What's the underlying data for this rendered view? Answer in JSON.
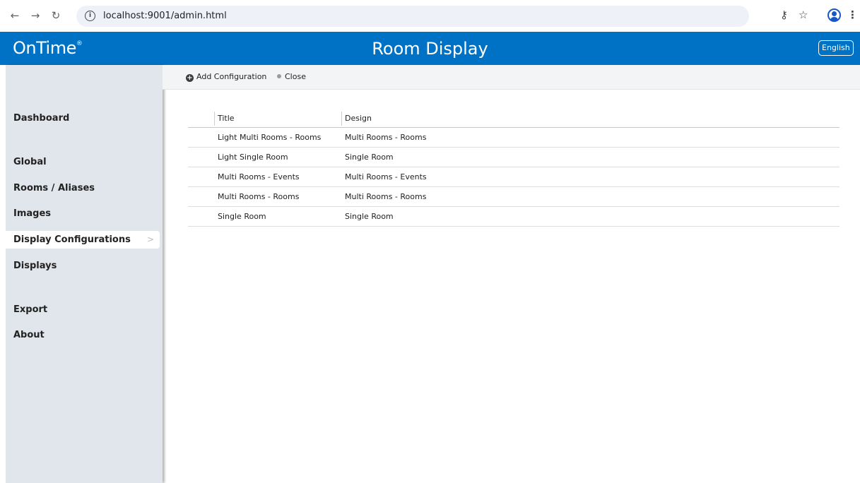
{
  "browser": {
    "url": "localhost:9001/admin.html",
    "back_glyph": "←",
    "forward_glyph": "→",
    "reload_glyph": "↻",
    "info_glyph": "i",
    "key_glyph": "⚷",
    "star_glyph": "☆",
    "menu_glyph": "⋮"
  },
  "header": {
    "logo": "OnTime",
    "logo_mark": "®",
    "title": "Room Display",
    "language": "English"
  },
  "sidebar": {
    "items": [
      {
        "label": "Dashboard"
      },
      {
        "label": "Global"
      },
      {
        "label": "Rooms / Aliases"
      },
      {
        "label": "Images"
      },
      {
        "label": "Display Configurations"
      },
      {
        "label": "Displays"
      },
      {
        "label": "Export"
      },
      {
        "label": "About"
      }
    ],
    "active_chevron": ">"
  },
  "toolbar": {
    "add_icon": "+",
    "add_label": "Add Configuration",
    "close_label": "Close"
  },
  "table": {
    "columns": [
      "Title",
      "Design"
    ],
    "rows": [
      {
        "title": "Light Multi Rooms - Rooms",
        "design": "Multi Rooms - Rooms"
      },
      {
        "title": "Light Single Room",
        "design": "Single Room"
      },
      {
        "title": "Multi Rooms - Events",
        "design": "Multi Rooms - Events"
      },
      {
        "title": "Multi Rooms - Rooms",
        "design": "Multi Rooms - Rooms"
      },
      {
        "title": "Single Room",
        "design": "Single Room"
      }
    ]
  },
  "colors": {
    "brand": "#0072c6",
    "sidebar_bg": "#e1e5ec",
    "toolbar_bg": "#f3f4f6"
  }
}
